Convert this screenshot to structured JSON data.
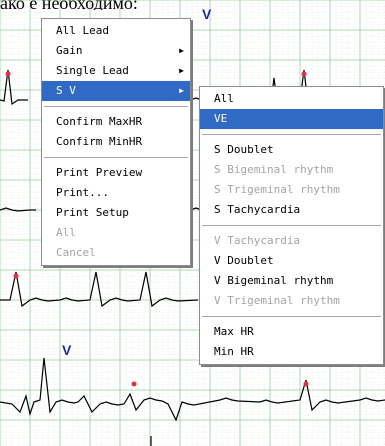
{
  "caption": "ако е необходимо:",
  "ecg_marker": "V",
  "colors": {
    "grid_minor": "#d4e8d4",
    "grid_major": "#9ccc9c",
    "trace": "#000000",
    "r_peak_dot": "#e23040",
    "v_label": "#1f2a9e",
    "menu_highlight": "#316ac5",
    "disabled_text": "#a4a4a4"
  },
  "context_menu": {
    "items": [
      {
        "label": "All Lead",
        "submenu": false,
        "disabled": false
      },
      {
        "label": "Gain",
        "submenu": true,
        "disabled": false
      },
      {
        "label": "Single Lead",
        "submenu": true,
        "disabled": false
      },
      {
        "label": "S V",
        "submenu": true,
        "disabled": false,
        "selected": true
      },
      {
        "separator": true
      },
      {
        "label": "Confirm MaxHR",
        "submenu": false,
        "disabled": false
      },
      {
        "label": "Confirm MinHR",
        "submenu": false,
        "disabled": false
      },
      {
        "separator": true
      },
      {
        "label": "Print Preview",
        "submenu": false,
        "disabled": false
      },
      {
        "label": "Print...",
        "submenu": false,
        "disabled": false,
        "underline_first": true
      },
      {
        "label": "Print Setup",
        "submenu": false,
        "disabled": false
      },
      {
        "label": "All",
        "submenu": false,
        "disabled": true
      },
      {
        "label": "Cancel",
        "submenu": false,
        "disabled": true
      }
    ]
  },
  "sv_submenu": {
    "items": [
      {
        "label": "All",
        "disabled": false
      },
      {
        "label": "VE",
        "disabled": false,
        "selected": true
      },
      {
        "separator": true
      },
      {
        "label": "S Doublet",
        "disabled": false
      },
      {
        "label": "S Bigeminal rhythm",
        "disabled": true
      },
      {
        "label": "S Trigeminal rhythm",
        "disabled": true
      },
      {
        "label": "S Tachycardia",
        "disabled": false
      },
      {
        "separator": true
      },
      {
        "label": "V Tachycardia",
        "disabled": true
      },
      {
        "label": "V Doublet",
        "disabled": false
      },
      {
        "label": "V Bigeminal rhythm",
        "disabled": false
      },
      {
        "label": "V Trigeminal rhythm",
        "disabled": true
      },
      {
        "separator": true
      },
      {
        "label": "Max HR",
        "disabled": false
      },
      {
        "label": "Min HR",
        "disabled": false
      }
    ]
  }
}
